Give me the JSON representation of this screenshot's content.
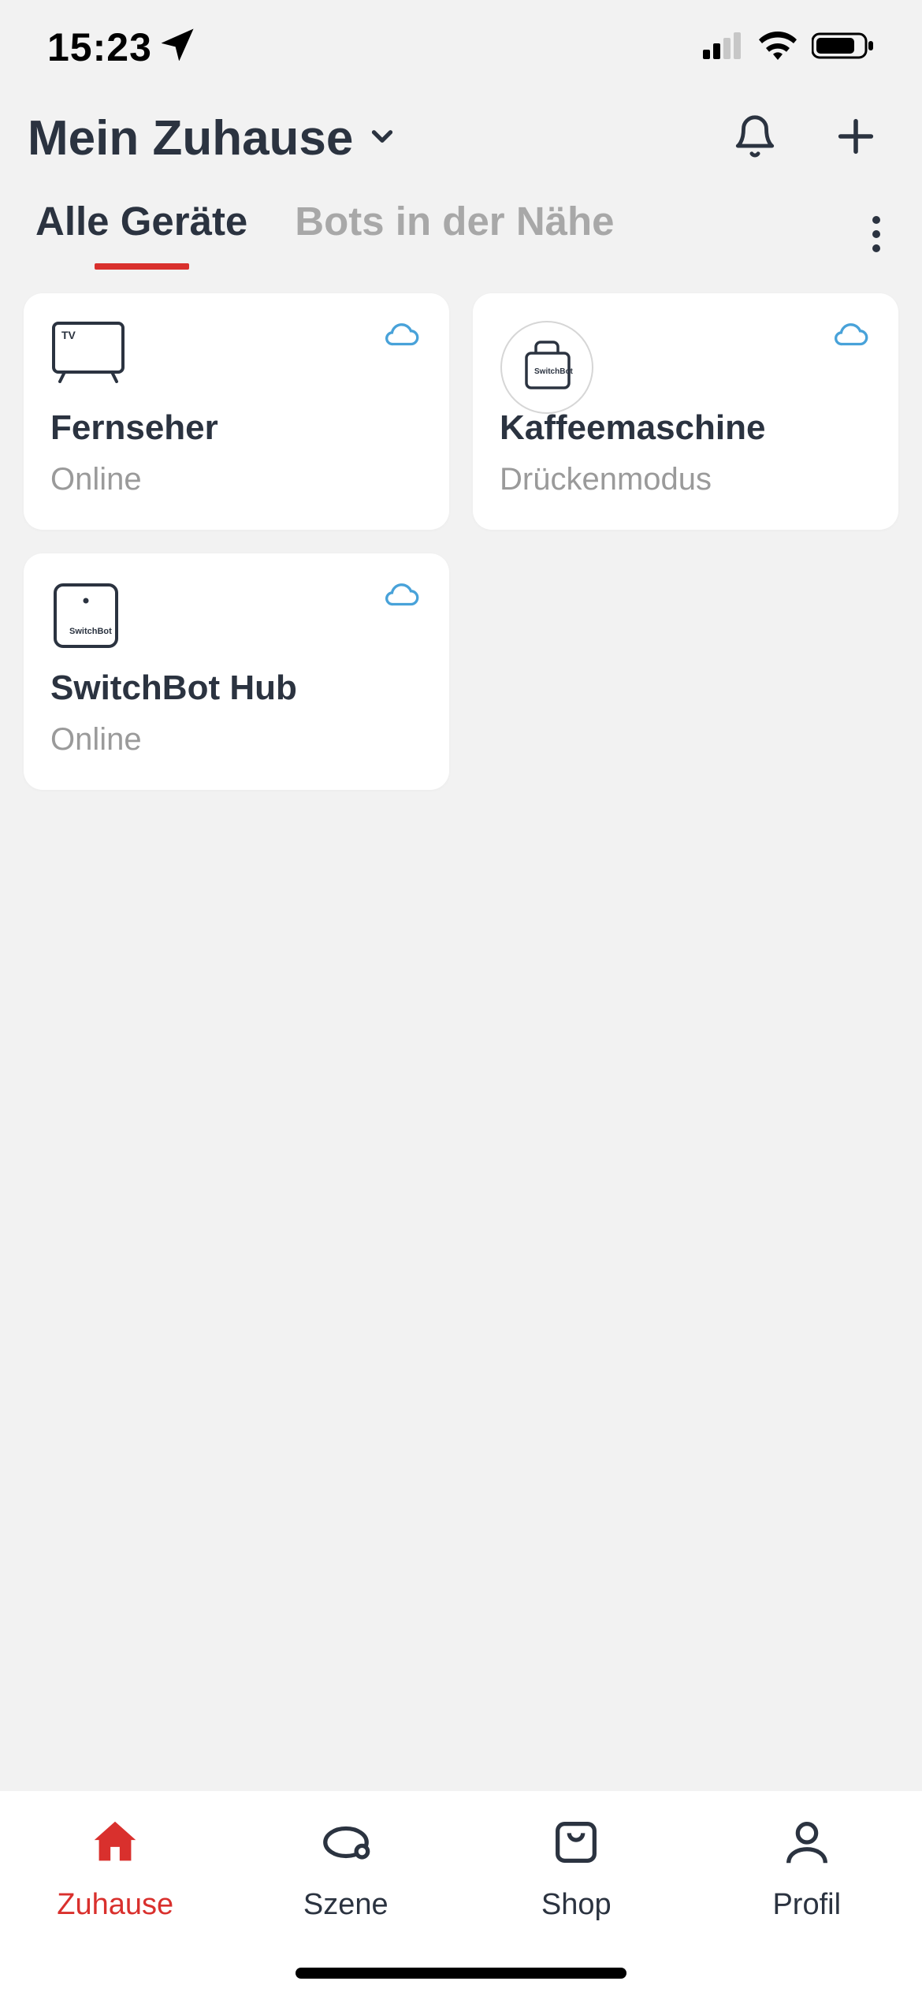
{
  "statusbar": {
    "time": "15:23"
  },
  "header": {
    "title": "Mein Zuhause"
  },
  "tabs": [
    {
      "label": "Alle Geräte",
      "active": true
    },
    {
      "label": "Bots in der Nähe",
      "active": false
    }
  ],
  "devices": [
    {
      "name": "Fernseher",
      "status": "Online",
      "icon": "tv"
    },
    {
      "name": "Kaffeemaschine",
      "status": "Drückenmodus",
      "icon": "switchbot-bot"
    },
    {
      "name": "SwitchBot Hub",
      "status": "Online",
      "icon": "switchbot-hub"
    }
  ],
  "nav": [
    {
      "label": "Zuhause",
      "active": true
    },
    {
      "label": "Szene",
      "active": false
    },
    {
      "label": "Shop",
      "active": false
    },
    {
      "label": "Profil",
      "active": false
    }
  ]
}
